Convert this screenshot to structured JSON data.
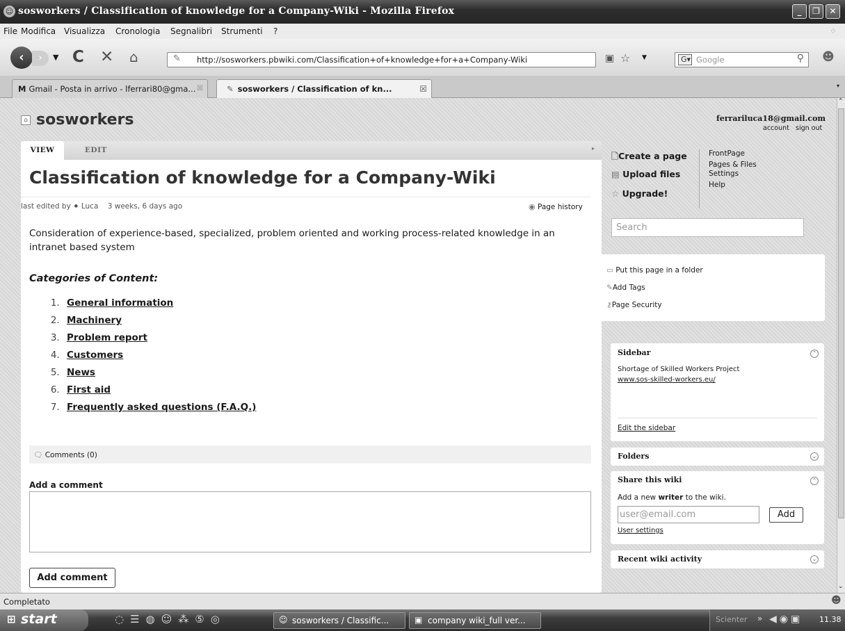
{
  "window": {
    "title": "sosworkers / Classification of knowledge for a Company-Wiki - Mozilla Firefox"
  },
  "menu": [
    "File",
    "Modifica",
    "Visualizza",
    "Cronologia",
    "Segnalibri",
    "Strumenti",
    "?"
  ],
  "nav": {
    "url": "http://sosworkers.pbwiki.com/Classification+of+knowledge+for+a+Company-Wiki",
    "search_placeholder": "Google"
  },
  "tabs": [
    {
      "label": "Gmail - Posta in arrivo - lferrari80@gma..."
    },
    {
      "label": "sosworkers / Classification of kn..."
    }
  ],
  "site": {
    "name": "sosworkers"
  },
  "user": {
    "email": "ferrariluca18@gmail.com",
    "account": "account",
    "signout": "sign out"
  },
  "view_tabs": {
    "view": "VIEW",
    "edit": "EDIT"
  },
  "article": {
    "title": "Classification of knowledge for a Company-Wiki",
    "edited_prefix": "last edited by",
    "editor": "Luca",
    "edited_when": "3 weeks, 6 days ago",
    "history": "Page history",
    "intro": "Consideration of experience-based, specialized, problem oriented and working process-related knowledge in an intranet based system",
    "categories_heading": "Categories of Content:",
    "categories": [
      "General information",
      "Machinery",
      "Problem report",
      "Customers",
      "News",
      "First aid",
      "Frequently asked questions (F.A.Q.)"
    ]
  },
  "comments": {
    "count_label": "Comments (0)",
    "add_heading": "Add a comment",
    "button": "Add comment"
  },
  "actions": {
    "create": "Create a page",
    "upload": "Upload files",
    "upgrade": "Upgrade!"
  },
  "links": [
    "FrontPage",
    "Pages & Files",
    "Settings",
    "Help"
  ],
  "search": {
    "placeholder": "Search"
  },
  "page_tools": [
    "Put this page in a folder",
    "Add Tags",
    "Page Security"
  ],
  "sidebar": {
    "title": "Sidebar",
    "text": "Shortage of Skilled Workers Project",
    "link": "www.sos-skilled-workers.eu/",
    "edit": "Edit the sidebar"
  },
  "folders": {
    "title": "Folders"
  },
  "share": {
    "title": "Share this wiki",
    "text_pre": "Add a new",
    "text_bold": "writer",
    "text_post": "to the wiki.",
    "placeholder": "user@email.com",
    "button": "Add",
    "settings": "User settings"
  },
  "recent": {
    "title": "Recent wiki activity"
  },
  "status": {
    "text": "Completato"
  },
  "taskbar": {
    "start": "start",
    "items": [
      "sosworkers / Classific...",
      "company wiki_full ver..."
    ],
    "tray_label": "Scienter",
    "clock": "11.38"
  }
}
